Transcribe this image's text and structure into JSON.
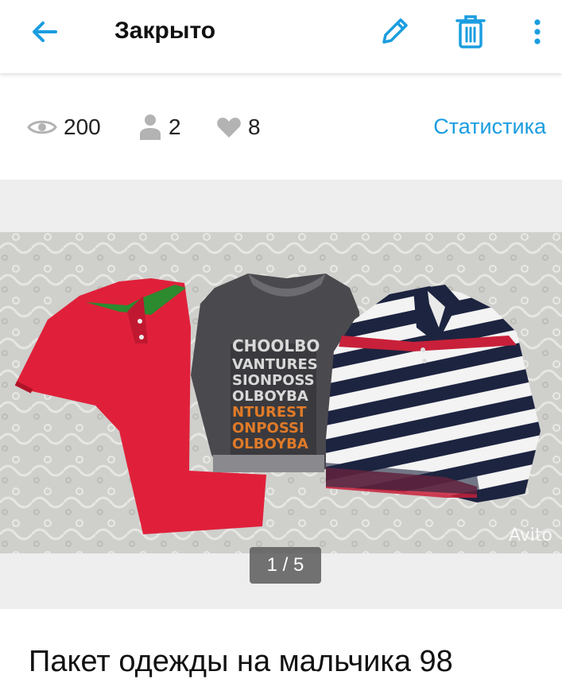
{
  "header": {
    "title": "Закрыто",
    "icons": [
      "arrow-back-icon",
      "pencil-icon",
      "trash-icon",
      "more-vert-icon"
    ],
    "accent_color": "#1a9de0"
  },
  "stats": {
    "views": "200",
    "contacts": "2",
    "favorites": "8",
    "link_label": "Статистика"
  },
  "gallery": {
    "counter": "1 / 5",
    "watermark": "Avito"
  },
  "listing": {
    "title": "Пакет одежды на мальчика 98"
  }
}
